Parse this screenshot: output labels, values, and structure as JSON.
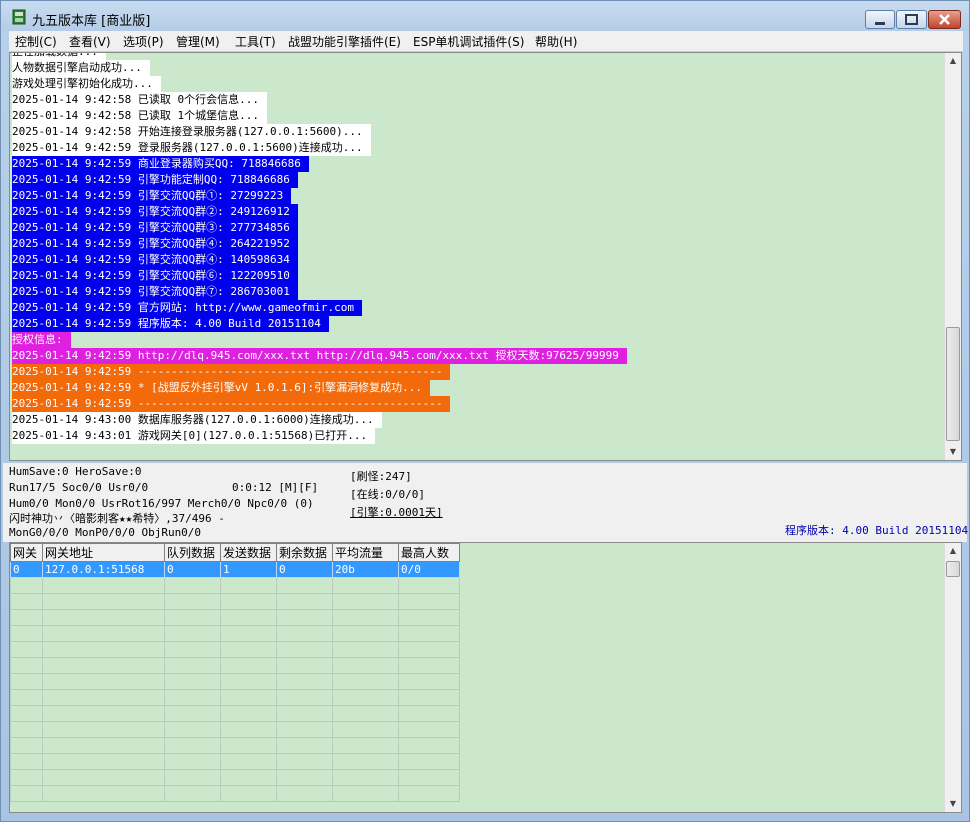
{
  "window": {
    "title": "九五版本库 [商业版]"
  },
  "menu": [
    "控制(C)",
    "查看(V)",
    "选项(P)",
    "管理(M)",
    "工具(T)",
    "战盟功能引擎插件(E)",
    "ESP单机调试插件(S)",
    "帮助(H)"
  ],
  "log": [
    {
      "text": "正在加载数据...",
      "style": "white"
    },
    {
      "text": "人物数据引擎启动成功...",
      "style": "white"
    },
    {
      "text": "游戏处理引擎初始化成功...",
      "style": "white"
    },
    {
      "text": "2025-01-14 9:42:58 已读取 0个行会信息...",
      "style": "white"
    },
    {
      "text": "2025-01-14 9:42:58 已读取 1个城堡信息...",
      "style": "white"
    },
    {
      "text": "2025-01-14 9:42:58 开始连接登录服务器(127.0.0.1:5600)...",
      "style": "white"
    },
    {
      "text": "2025-01-14 9:42:59 登录服务器(127.0.0.1:5600)连接成功...",
      "style": "white"
    },
    {
      "text": "2025-01-14 9:42:59 商业登录器购买QQ: 718846686",
      "style": "blue"
    },
    {
      "text": "2025-01-14 9:42:59 引擎功能定制QQ: 718846686",
      "style": "blue"
    },
    {
      "text": "2025-01-14 9:42:59 引擎交流QQ群①: 27299223",
      "style": "blue"
    },
    {
      "text": "2025-01-14 9:42:59 引擎交流QQ群②: 249126912",
      "style": "blue"
    },
    {
      "text": "2025-01-14 9:42:59 引擎交流QQ群③: 277734856",
      "style": "blue"
    },
    {
      "text": "2025-01-14 9:42:59 引擎交流QQ群④: 264221952",
      "style": "blue"
    },
    {
      "text": "2025-01-14 9:42:59 引擎交流QQ群④: 140598634",
      "style": "blue"
    },
    {
      "text": "2025-01-14 9:42:59 引擎交流QQ群⑥: 122209510",
      "style": "blue"
    },
    {
      "text": "2025-01-14 9:42:59 引擎交流QQ群⑦: 286703001",
      "style": "blue"
    },
    {
      "text": "2025-01-14 9:42:59 官方网站: http://www.gameofmir.com",
      "style": "blue"
    },
    {
      "text": "2025-01-14 9:42:59 程序版本: 4.00 Build 20151104",
      "style": "blue"
    },
    {
      "text": "授权信息:",
      "style": "magenta"
    },
    {
      "text": "2025-01-14 9:42:59 http://dlq.945.com/xxx.txt http://dlq.945.com/xxx.txt 授权天数:97625/99999",
      "style": "magenta"
    },
    {
      "text": "2025-01-14 9:42:59 ----------------------------------------------",
      "style": "orange"
    },
    {
      "text": "2025-01-14 9:42:59 * [战盟反外挂引擎vV 1.0.1.6]:引擎漏洞修复成功...",
      "style": "orange"
    },
    {
      "text": "2025-01-14 9:42:59 ----------------------------------------------",
      "style": "orange"
    },
    {
      "text": "2025-01-14 9:43:00 数据库服务器(127.0.0.1:6000)连接成功...",
      "style": "white"
    },
    {
      "text": "2025-01-14 9:43:01 游戏网关[0](127.0.0.1:51568)已打开...",
      "style": "white"
    }
  ],
  "status": {
    "humsave": "HumSave:0 HeroSave:0",
    "run": "Run17/5 Soc0/0 Usr0/0",
    "time": "0:0:12 [M][F]",
    "hum": "Hum0/0 Mon0/0 UsrRot16/997 Merch0/0 Npc0/0 (0)",
    "skill": "闪时神功丷〈暗影刺客★★希特〉,37/496 -",
    "mong": "MonG0/0/0 MonP0/0/0 ObjRun0/0",
    "refresh": "[刷怪:247]",
    "online": "[在线:0/0/0]",
    "engine": "[引擎:0.0001天]",
    "version": "程序版本: 4.00 Build 20151104"
  },
  "grid": {
    "headers": [
      "网关",
      "网关地址",
      "队列数据",
      "发送数据",
      "剩余数据",
      "平均流量",
      "最高人数"
    ],
    "rows": [
      [
        "0",
        "127.0.0.1:51568",
        "0",
        "1",
        "0",
        "20b",
        "0/0"
      ]
    ]
  },
  "colors": {
    "log_bg": "#cce8cc",
    "blue_highlight": "#0000ee",
    "magenta_highlight": "#e020e0",
    "orange_highlight": "#f26a0a",
    "selection": "#3399ff"
  },
  "icons": {
    "app": "app-icon",
    "minimize": "minimize-icon",
    "maximize": "maximize-icon",
    "close": "close-icon"
  }
}
